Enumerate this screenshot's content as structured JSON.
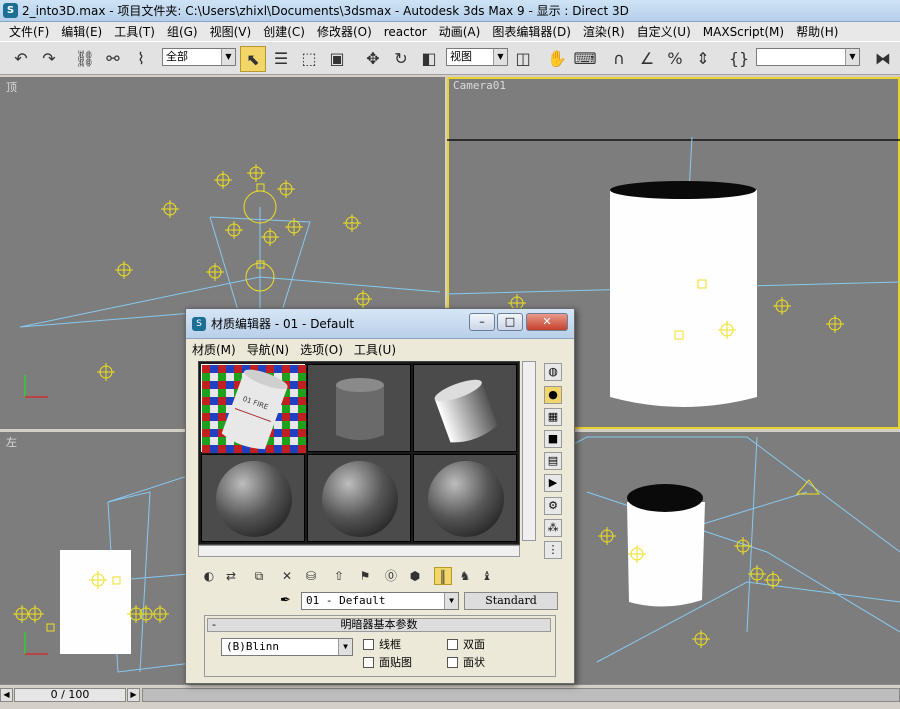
{
  "window": {
    "title": "2_into3D.max    - 项目文件夹: C:\\Users\\zhixl\\Documents\\3dsmax     - Autodesk 3ds Max 9       - 显示 : Direct 3D"
  },
  "menu": [
    "文件(F)",
    "编辑(E)",
    "工具(T)",
    "组(G)",
    "视图(V)",
    "创建(C)",
    "修改器(O)",
    "reactor",
    "动画(A)",
    "图表编辑器(D)",
    "渲染(R)",
    "自定义(U)",
    "MAXScript(M)",
    "帮助(H)"
  ],
  "toolbar": {
    "selection_filter": "全部",
    "ref_coord": "视图",
    "named_sel": ""
  },
  "viewports": {
    "top": "顶",
    "camera": "Camera01",
    "left": "左"
  },
  "status": {
    "frame": "0 / 100"
  },
  "material_editor": {
    "title": "材质编辑器 - 01 - Default",
    "menu": [
      "材质(M)",
      "导航(N)",
      "选项(O)",
      "工具(U)"
    ],
    "material_name": "01 - Default",
    "material_type": "Standard",
    "rollout_title": "明暗器基本参数",
    "shader": "(B)Blinn",
    "options": {
      "wire": "线框",
      "two_sided": "双面",
      "face_map": "面贴图",
      "faceted": "面状"
    },
    "label_texture": "01 FIRE"
  },
  "colors": {
    "viewport_bg": "#7d7d7d",
    "active_border": "#e8d230",
    "helper": "#f0e020",
    "light_line": "#88c8f0"
  }
}
